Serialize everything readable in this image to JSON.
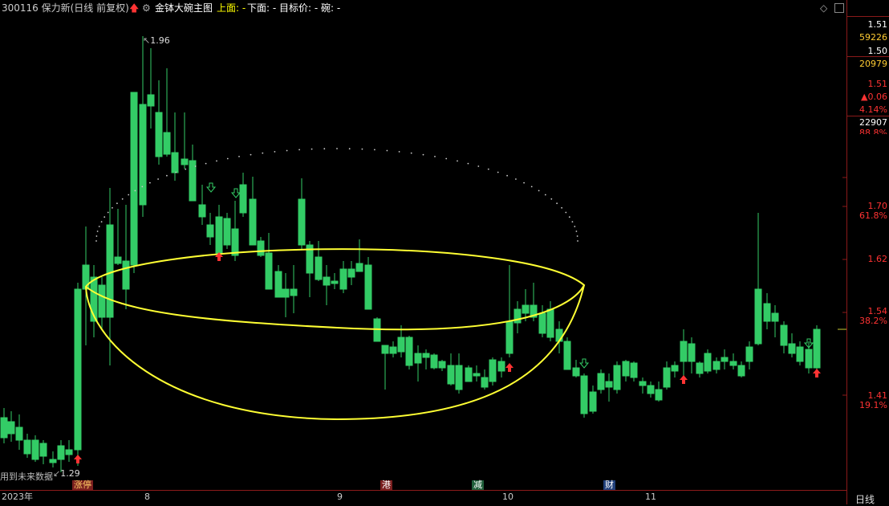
{
  "header": {
    "code_name": "300116 保力新(日线 前复权)",
    "indicator": "金钵大碗主图",
    "upper_label": "上面: -",
    "lower_label": "下面: -",
    "target_label": "目标价: -",
    "bowl_label": "碗: -",
    "colors": {
      "title": "#cccccc",
      "upper": "#ffff00",
      "lower": "#ffffff",
      "target": "#ffffff",
      "bowl": "#ffffff"
    }
  },
  "right_panel": {
    "quotes": [
      {
        "text": "1.51",
        "color": "#ffffff"
      },
      {
        "text": "59226",
        "color": "#ffcc33"
      },
      {
        "text": "1.50",
        "color": "#ffffff"
      },
      {
        "text": "20979",
        "color": "#ffcc33"
      },
      {
        "text": "1.51",
        "color": "#ff3333"
      },
      {
        "text": "▲0.06",
        "color": "#ff3333"
      },
      {
        "text": "4.14%",
        "color": "#ff3333"
      },
      {
        "text": "22907",
        "color": "#ffffff"
      }
    ],
    "partial_label": "88.8%",
    "y_axis": [
      {
        "price": "1.70",
        "pct": "61.8%"
      },
      {
        "price": "1.62",
        "pct": ""
      },
      {
        "price": "1.54",
        "pct": "38.2%"
      },
      {
        "price": "1.41",
        "pct": "19.1%"
      }
    ],
    "period_button": "日线"
  },
  "annotations": {
    "high_label": "1.96",
    "low_label": "1.29",
    "future_data_label": "用到未来数据"
  },
  "x_axis": {
    "labels": [
      "2023年",
      "8",
      "9",
      "10",
      "11"
    ]
  },
  "event_tags": [
    {
      "text": "涨停",
      "color": "#c0392b"
    },
    {
      "text": "港",
      "color": "#c0392b"
    },
    {
      "text": "减",
      "color": "#2e8b57"
    },
    {
      "text": "财",
      "color": "#2a5caa"
    }
  ],
  "colors": {
    "up": "#ff3333",
    "down": "#33cc66",
    "doji": "#ffffff",
    "bowl": "#ffff33",
    "axis": "#8b1a1a"
  }
}
